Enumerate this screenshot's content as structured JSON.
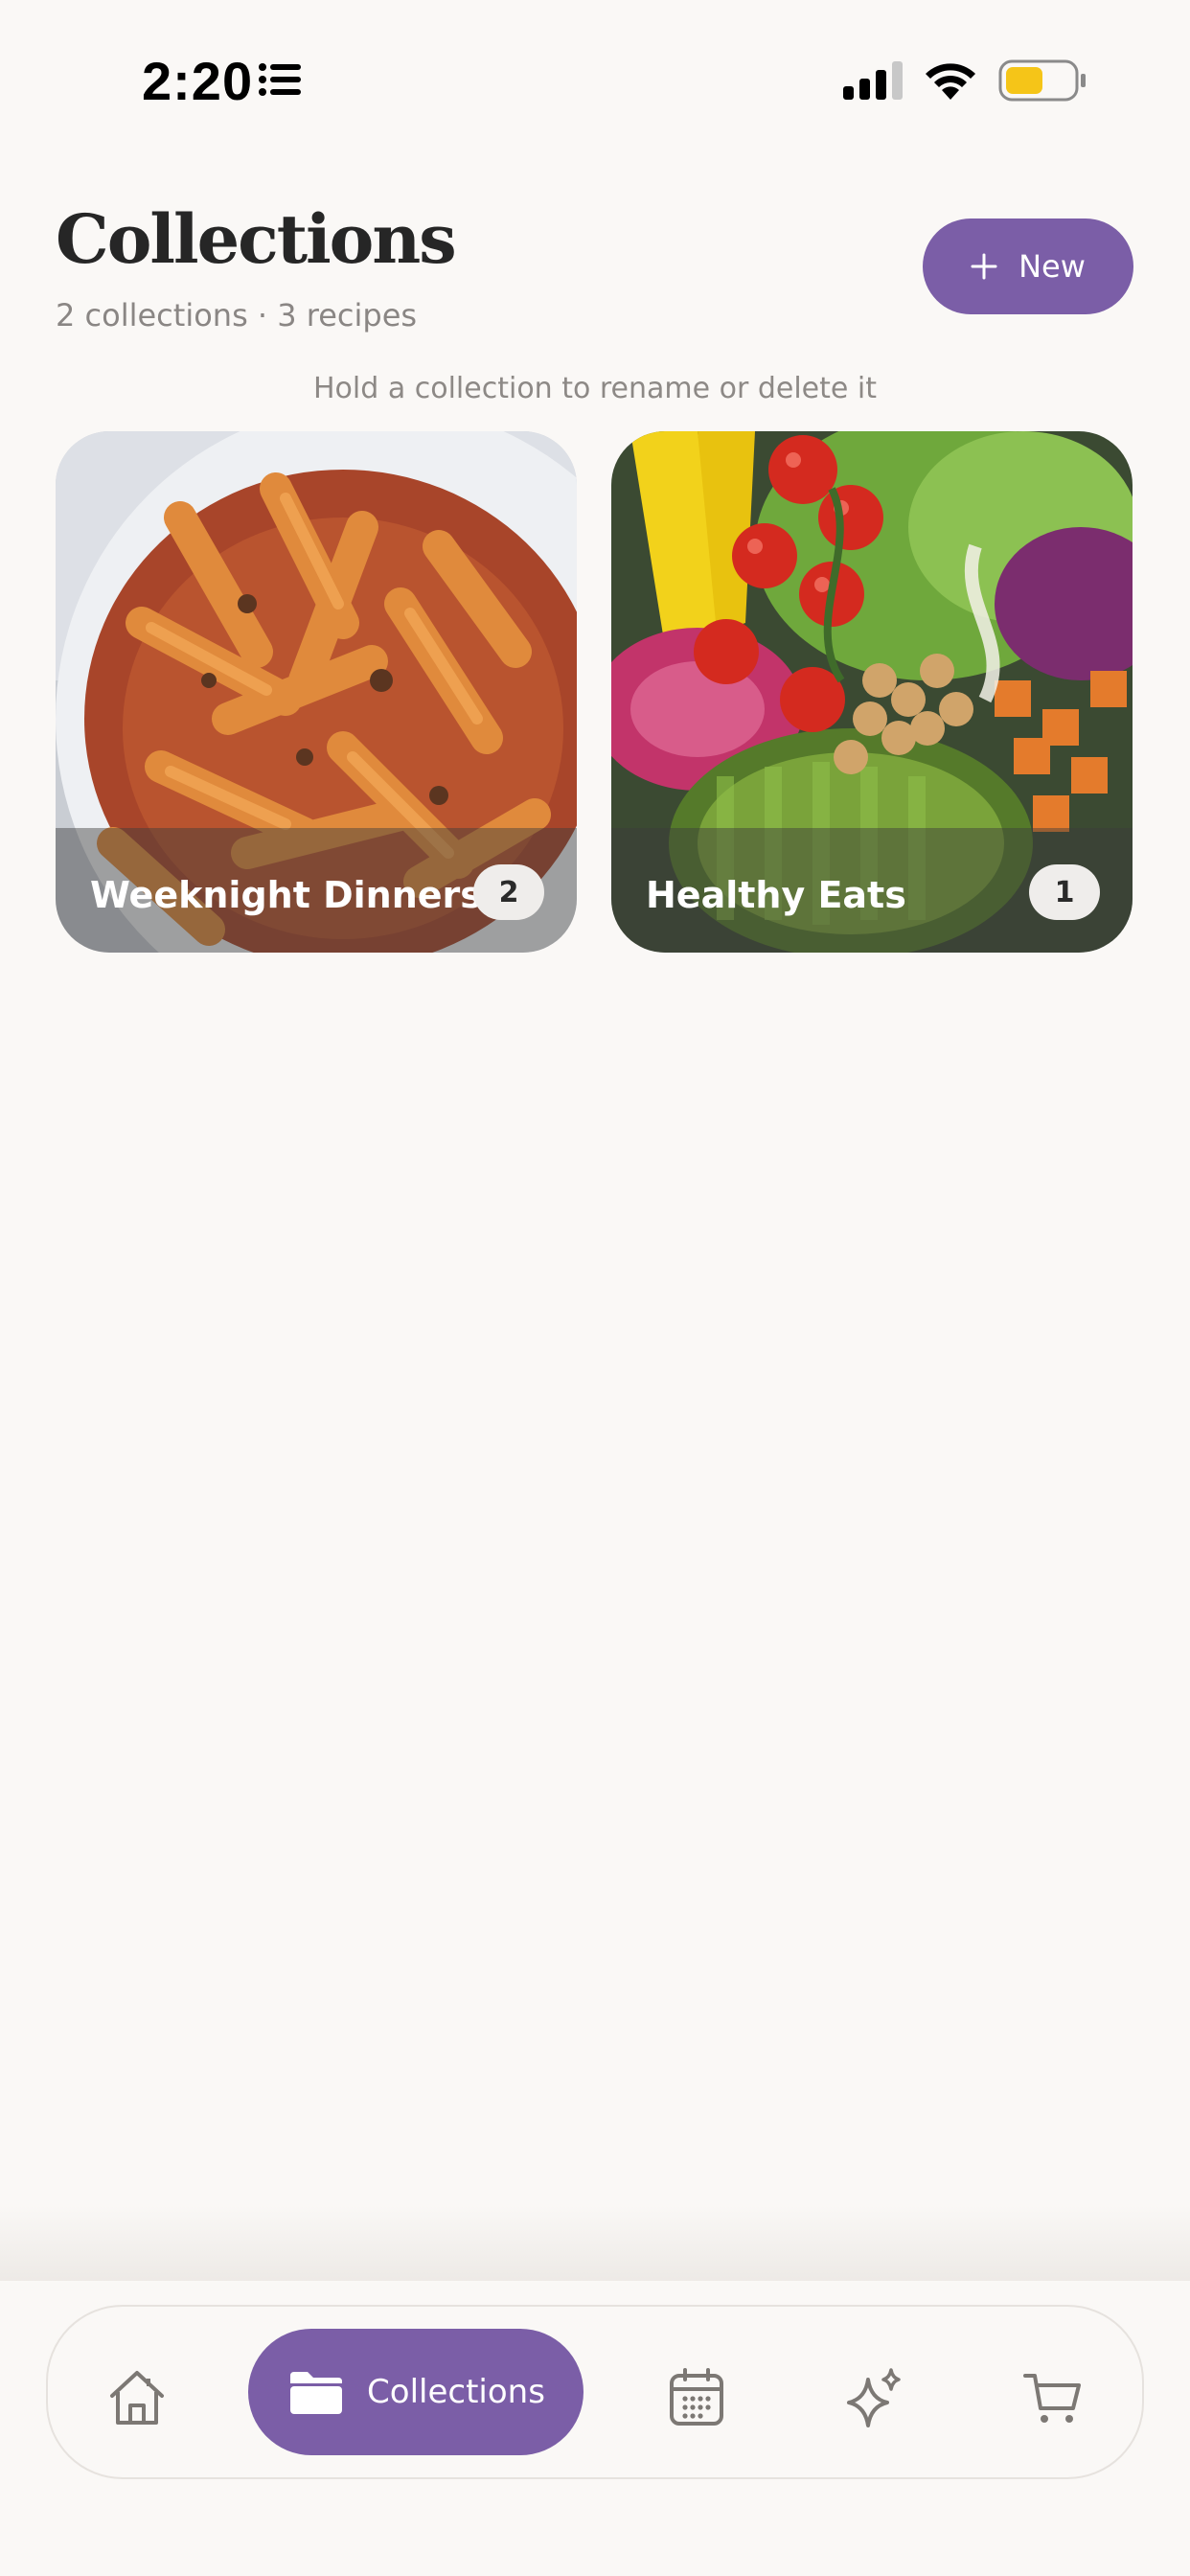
{
  "status_bar": {
    "time": "2:20",
    "battery_color": "#f5c518"
  },
  "header": {
    "title": "Collections",
    "subtitle": "2 collections · 3 recipes",
    "new_button_label": "New"
  },
  "hint": "Hold a collection to rename or delete it",
  "collections": [
    {
      "title": "Weeknight Dinners",
      "count": "2",
      "image": "penne-pasta"
    },
    {
      "title": "Healthy Eats",
      "count": "1",
      "image": "salad-bowl"
    }
  ],
  "nav": {
    "items": [
      {
        "name": "home",
        "icon": "home-icon"
      },
      {
        "name": "collections",
        "icon": "folder-icon",
        "label": "Collections",
        "active": true
      },
      {
        "name": "planner",
        "icon": "calendar-icon"
      },
      {
        "name": "discover",
        "icon": "sparkle-icon"
      },
      {
        "name": "shopping",
        "icon": "cart-icon"
      }
    ]
  },
  "colors": {
    "accent": "#7b5ea7",
    "background": "#faf8f6"
  }
}
